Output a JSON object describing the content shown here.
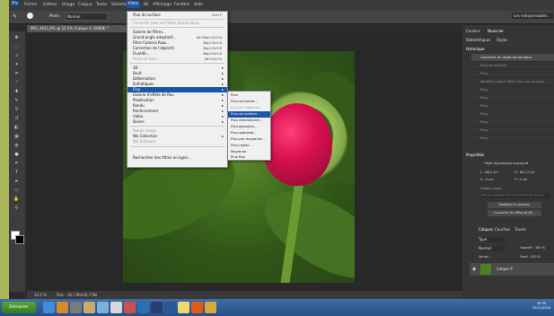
{
  "app": {
    "logo": "Ps"
  },
  "menubar": [
    "Fichier",
    "Edition",
    "Image",
    "Calque",
    "Texte",
    "Sélection",
    "Filtre",
    "3D",
    "Affichage",
    "Fenêtre",
    "Aide"
  ],
  "options": {
    "mode": "Normal",
    "workspace": "Les indispensables"
  },
  "document": {
    "tab_title": "IMG_4451.JPG @ 22,5% (Calque 0, RVB/8) *",
    "status": "22,5 %",
    "doc_info": "Doc : 16,7 Mo/16,7 Mo"
  },
  "filter_menu": {
    "items": [
      {
        "label": "Flou de surface",
        "shortcut": "Ctrl+F"
      },
      {
        "label": "Convertir pour les filtres dynamiques",
        "disabled": true
      },
      {
        "label": "Galerie de filtres..."
      },
      {
        "label": "Grand-angle adaptatif...",
        "shortcut": "Alt+Maj+Ctrl+A"
      },
      {
        "label": "Filtre Camera Raw...",
        "shortcut": "Maj+Ctrl+A"
      },
      {
        "label": "Correction de l'objectif...",
        "shortcut": "Maj+Ctrl+R"
      },
      {
        "label": "Fluidité...",
        "shortcut": "Maj+Ctrl+X"
      },
      {
        "label": "Point de fuite...",
        "shortcut": "Alt+Ctrl+V",
        "disabled": true
      },
      {
        "label": "3D",
        "submenu": true
      },
      {
        "label": "Bruit",
        "submenu": true
      },
      {
        "label": "Déformation",
        "submenu": true
      },
      {
        "label": "Esthétiques",
        "submenu": true
      },
      {
        "label": "Flou",
        "submenu": true,
        "selected": true
      },
      {
        "label": "Galerie d'effets de flou",
        "submenu": true
      },
      {
        "label": "Pixellisation",
        "submenu": true
      },
      {
        "label": "Rendu",
        "submenu": true
      },
      {
        "label": "Renforcement",
        "submenu": true
      },
      {
        "label": "Vidéo",
        "submenu": true
      },
      {
        "label": "Divers",
        "submenu": true
      },
      {
        "label": "Rendu image",
        "disabled": true
      },
      {
        "label": "Nik Collection",
        "submenu": true
      },
      {
        "label": "Nik Software",
        "disabled": true
      },
      {
        "label": "Rechercher des filtres en ligne..."
      }
    ]
  },
  "blur_submenu": {
    "items": [
      {
        "label": "Flou"
      },
      {
        "label": "Flou de forme..."
      },
      {
        "label": "Flou de l'objectif...",
        "disabled": true
      },
      {
        "label": "Flou de surface...",
        "selected": true
      },
      {
        "label": "Flou directionnel..."
      },
      {
        "label": "Flou gaussien..."
      },
      {
        "label": "Flou optimisé..."
      },
      {
        "label": "Flou par moyenne..."
      },
      {
        "label": "Flou radial..."
      },
      {
        "label": "Moyenne"
      },
      {
        "label": "Plus flou"
      }
    ]
  },
  "right_panel": {
    "top_tabs": [
      "Couleur",
      "Nuancier"
    ],
    "hist_tabs": [
      "Bibliothèques",
      "Styles"
    ],
    "history_title": "Historique",
    "history": [
      "Convertir en objet dynamique",
      "Flou de surface",
      "Flou",
      "Modifier l'objet filtre (Flou de surface)",
      "Flou",
      "Flou",
      "Flou",
      "Flou",
      "Flou",
      "Flou",
      "Flou"
    ],
    "props_title": "Propriétés",
    "props_type": "Objet dynamique incorporé",
    "props_fields": [
      "L : 86,2 cm",
      "H : 86,17 cm",
      "X : 0 cm",
      "Y : 0 cm"
    ],
    "props_note": "Calque Comp",
    "props_note2": "Ne pas appliquer à la composition de calques",
    "btn_edit": "Modifier le contenu",
    "btn_convert": "Convertir en détouré lié...",
    "layers_tabs": [
      "Calques",
      "Couches",
      "Tracés"
    ],
    "layers_kind": "Type",
    "layers_mode": "Normal",
    "layers_opacity": "Opacité : 100 %",
    "layers_lock": "Verrou :",
    "layers_fill": "Fond : 100 %",
    "layer_name": "Calque 0"
  },
  "taskbar": {
    "start_label": "Démarrer",
    "time": "20:30",
    "date": "20/11/2016",
    "app_colors": [
      "#3f8dd8",
      "#d88a2b",
      "#7a7a7a",
      "#caa96a",
      "#7bb0d6",
      "#d8d8d8",
      "#d04e4e",
      "#2a6fb1",
      "#2a3c6e",
      "#2b5796",
      "#f0d96c",
      "#e25a1a",
      "#d7a93a"
    ]
  }
}
